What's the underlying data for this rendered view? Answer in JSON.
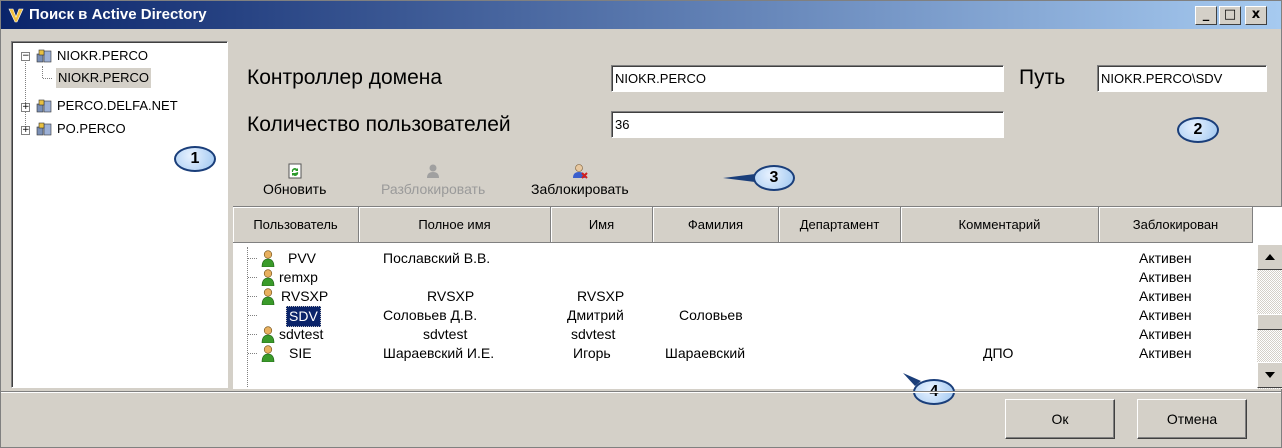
{
  "window": {
    "title": "Поиск в Active Directory"
  },
  "titlebar_buttons": {
    "minimize": "_",
    "maximize": "□",
    "close": "x"
  },
  "tree": [
    {
      "label": "NIOKR.PERCO",
      "expanded": true
    },
    {
      "label": "NIOKR.PERCO",
      "child": true
    },
    {
      "label": "PERCO.DELFA.NET",
      "expanded": false
    },
    {
      "label": "PO.PERCO",
      "expanded": false
    }
  ],
  "form": {
    "domain_controller_label": "Контроллер домена",
    "domain_controller_value": "NIOKR.PERCO",
    "path_label": "Путь",
    "path_value": "NIOKR.PERCO\\SDV",
    "user_count_label": "Количество пользователей",
    "user_count_value": "36"
  },
  "toolbar": {
    "refresh": "Обновить",
    "unlock": "Разблокировать",
    "lock": "Заблокировать"
  },
  "table": {
    "columns": [
      "Пользователь",
      "Полное имя",
      "Имя",
      "Фамилия",
      "Департамент",
      "Комментарий",
      "Заблокирован"
    ],
    "rows": [
      {
        "user": "PVV",
        "full_name": "Пославский В.В.",
        "first": "",
        "last": "",
        "dept": "",
        "comment": "",
        "status": "Активен",
        "icon": true
      },
      {
        "user": "remxp",
        "full_name": "",
        "first": "",
        "last": "",
        "dept": "",
        "comment": "",
        "status": "Активен",
        "icon": true
      },
      {
        "user": "RVSXP",
        "full_name": "RVSXP",
        "first": "RVSXP",
        "last": "",
        "dept": "",
        "comment": "",
        "status": "Активен",
        "icon": true
      },
      {
        "user": "SDV",
        "full_name": "Соловьев Д.В.",
        "first": "Дмитрий",
        "last": "Соловьев",
        "dept": "",
        "comment": "",
        "status": "Активен",
        "icon": false,
        "selected": true
      },
      {
        "user": "sdvtest",
        "full_name": "sdvtest",
        "first": "sdvtest",
        "last": "",
        "dept": "",
        "comment": "",
        "status": "Активен",
        "icon": true
      },
      {
        "user": "SIE",
        "full_name": "Шараевский И.Е.",
        "first": "Игорь",
        "last": "Шараевский",
        "dept": "",
        "comment": "ДПО",
        "status": "Активен",
        "icon": true
      }
    ]
  },
  "callouts": [
    "1",
    "2",
    "3",
    "4"
  ],
  "buttons": {
    "ok": "Ок",
    "cancel": "Отмена"
  },
  "colors": {
    "title_start": "#0a246a",
    "title_end": "#a6caf0",
    "face": "#d4d0c8",
    "selection": "#0a246a",
    "callout_fill": "#9ec6f0"
  }
}
